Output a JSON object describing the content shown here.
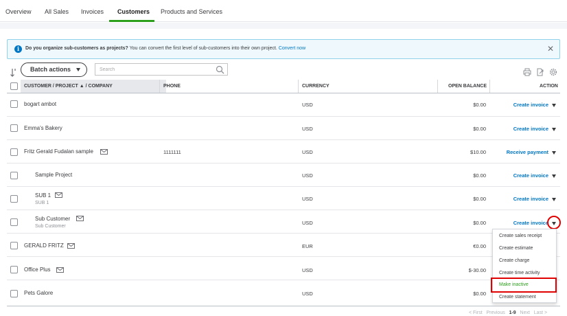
{
  "tabs": [
    {
      "label": "Overview"
    },
    {
      "label": "All Sales"
    },
    {
      "label": "Invoices"
    },
    {
      "label": "Customers"
    },
    {
      "label": "Products and Services"
    }
  ],
  "banner": {
    "bold_text": "Do you organize sub-customers as projects?",
    "text": " You can convert the first level of sub-customers into their own project.",
    "link": "Convert now"
  },
  "toolbar": {
    "batch_actions": "Batch actions",
    "search_placeholder": "Search"
  },
  "table": {
    "headers": {
      "customer": "CUSTOMER / PROJECT ▲ / COMPANY",
      "phone": "PHONE",
      "currency": "CURRENCY",
      "balance": "OPEN BALANCE",
      "action": "ACTION"
    },
    "rows": [
      {
        "name": "bogart ambot",
        "sub": "",
        "phone": "",
        "currency": "USD",
        "balance": "$0.00",
        "action": "Create invoice"
      },
      {
        "name": "Emma's Bakery",
        "sub": "",
        "phone": "",
        "currency": "USD",
        "balance": "$0.00",
        "action": "Create invoice"
      },
      {
        "name": "Fritz Gerald Fudalan sample",
        "sub": "",
        "phone": "1111111",
        "currency": "USD",
        "balance": "$10.00",
        "action": "Receive payment"
      },
      {
        "name": "Sample Project",
        "sub": "",
        "phone": "",
        "currency": "USD",
        "balance": "$0.00",
        "action": "Create invoice"
      },
      {
        "name": "SUB 1",
        "sub": "SUB 1",
        "phone": "",
        "currency": "USD",
        "balance": "$0.00",
        "action": "Create invoice"
      },
      {
        "name": "Sub Customer",
        "sub": "Sub Customer",
        "phone": "",
        "currency": "USD",
        "balance": "$0.00",
        "action": "Create invoice"
      },
      {
        "name": "GERALD FRITZ",
        "sub": "",
        "phone": "",
        "currency": "EUR",
        "balance": "€0.00",
        "action": ""
      },
      {
        "name": "Office Plus",
        "sub": "",
        "phone": "",
        "currency": "USD",
        "balance": "$-30.00",
        "action": ""
      },
      {
        "name": "Pets Galore",
        "sub": "",
        "phone": "",
        "currency": "USD",
        "balance": "$0.00",
        "action": ""
      }
    ]
  },
  "dropdown": {
    "items": [
      "Create sales receipt",
      "Create estimate",
      "Create charge",
      "Create time activity",
      "Make inactive",
      "Create statement"
    ]
  },
  "pager": {
    "first": "< First",
    "previous": "Previous",
    "range": "1-9",
    "next": "Next",
    "last": "Last >"
  },
  "colors": {
    "accent": "#2ca01c",
    "link": "#0077c5",
    "highlight": "#e00000"
  }
}
